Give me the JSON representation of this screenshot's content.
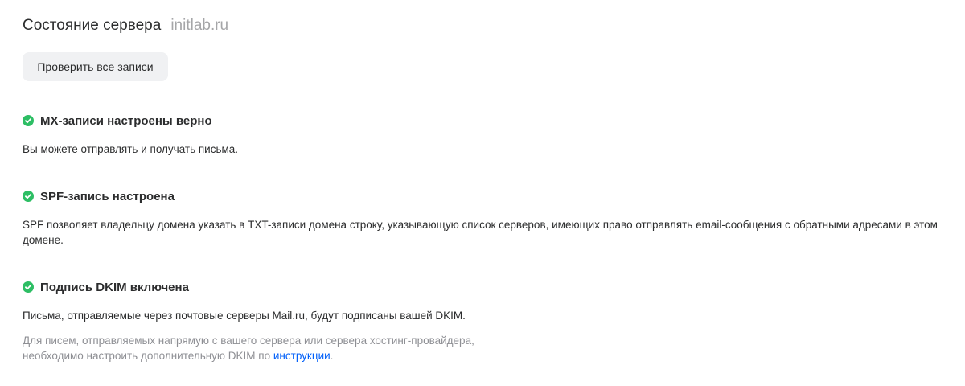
{
  "header": {
    "title": "Состояние сервера",
    "domain": "initlab.ru"
  },
  "actions": {
    "check_all_label": "Проверить все записи"
  },
  "sections": [
    {
      "status": "success",
      "icon": "check-circle-icon",
      "title": "MX-записи настроены верно",
      "text": "Вы можете отправлять и получать письма."
    },
    {
      "status": "success",
      "icon": "check-circle-icon",
      "title": "SPF-запись настроена",
      "text": "SPF позволяет владельцу домена указать в TXT-записи домена строку, указывающую список серверов, имеющих право отправлять email-сообщения с обратными адресами в этом домене."
    },
    {
      "status": "success",
      "icon": "check-circle-icon",
      "title": "Подпись DKIM включена",
      "text": "Письма, отправляемые через почтовые серверы Mail.ru, будут подписаны вашей DKIM.",
      "note": {
        "line1": "Для писем, отправляемых напрямую с вашего сервера или сервера хостинг-провайдера,",
        "line2_prefix": "необходимо настроить дополнительную DKIM по ",
        "link_label": "инструкции",
        "line2_suffix": "."
      }
    }
  ],
  "colors": {
    "success": "#2dbe64",
    "link": "#005ff9",
    "muted": "#8e8f94",
    "button_bg": "#f0f1f3"
  }
}
